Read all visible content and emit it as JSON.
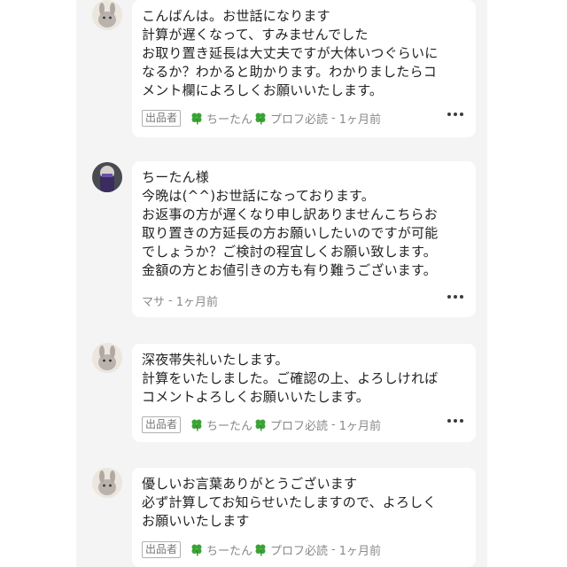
{
  "comments": [
    {
      "author_type": "seller",
      "badge": "出品者",
      "name_before": "ちーたん",
      "name_after": "プロフ必読",
      "separator": "-",
      "time": "1ヶ月前",
      "text": "こんばんは。お世話になります\n計算が遅くなって、すみませんでした\nお取り置き延長は大丈夫ですが大体いつぐらいに\nなるか？わかると助かります。わかりましたらコ\nメント欄によろしくお願いいたします。"
    },
    {
      "author_type": "buyer",
      "name": "マサ",
      "separator": "-",
      "time": "1ヶ月前",
      "text": "ちーたん様\n今晩は(^^)お世話になっております。\nお返事の方が遅くなり申し訳ありませんこちらお\n取り置きの方延長の方お願いしたいのですが可能\nでしょうか？ご検討の程宜しくお願い致します。\n金額の方とお値引きの方も有り難うございます。"
    },
    {
      "author_type": "seller",
      "badge": "出品者",
      "name_before": "ちーたん",
      "name_after": "プロフ必読",
      "separator": "-",
      "time": "1ヶ月前",
      "text": "深夜帯失礼いたします。\n計算をいたしました。ご確認の上、よろしければ\nコメントよろしくお願いいたします。"
    },
    {
      "author_type": "seller",
      "badge": "出品者",
      "name_before": "ちーたん",
      "name_after": "プロフ必読",
      "separator": "-",
      "time": "1ヶ月前",
      "text": "優しいお言葉ありがとうございます\n必ず計算してお知らせいたしますので、よろしく\nお願いいたします"
    }
  ],
  "colors": {
    "panel_bg": "#f4f4f4",
    "bubble_bg": "#ffffff",
    "clover": "#3aa335",
    "buyer_avatar": "#3a2c5e"
  },
  "icons": {
    "clover": "four-leaf-clover-icon",
    "more": "more-dots-icon"
  }
}
